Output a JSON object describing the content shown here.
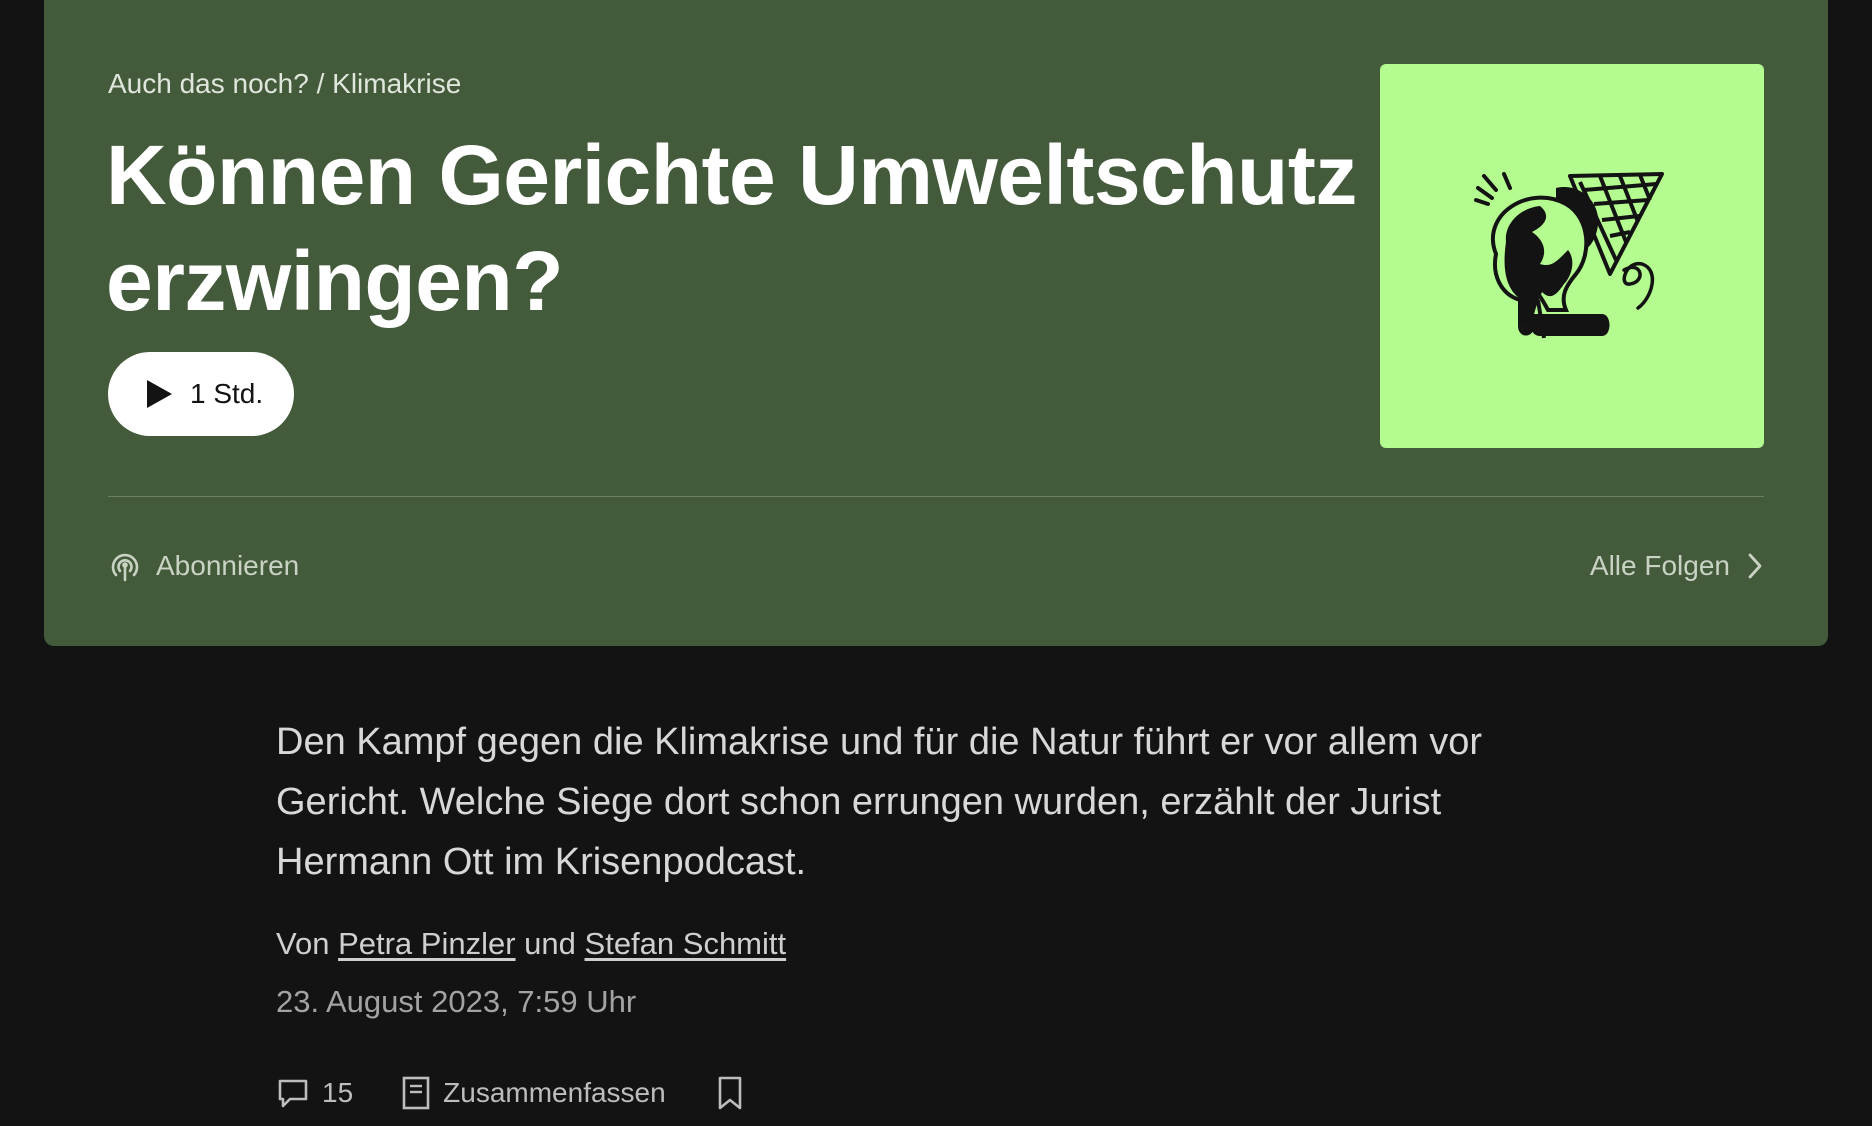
{
  "hero": {
    "breadcrumb": "Auch das noch? / Klimakrise",
    "title": "Können Gerichte Umweltschutz erzwingen?",
    "play_label": "1 Std.",
    "subscribe_label": "Abonnieren",
    "all_episodes_label": "Alle Folgen",
    "cover_icon": "melting-earth-ice-cream-icon"
  },
  "article": {
    "summary": "Den Kampf gegen die Klimakrise und für die Natur führt er vor allem vor Gericht. Welche Siege dort schon errungen wurden, erzählt der Jurist Hermann Ott im Krisenpodcast.",
    "byline_prefix": "Von",
    "author_1": "Petra Pinzler",
    "byline_joiner": "und",
    "author_2": "Stefan Schmitt",
    "date": "23. August 2023, 7:59 Uhr"
  },
  "actions": {
    "comment_count": "15",
    "summarize_label": "Zusammenfassen"
  },
  "colors": {
    "page_bg": "#131313",
    "hero_bg": "#435a3b",
    "cover_bg": "#b4fc8f"
  }
}
